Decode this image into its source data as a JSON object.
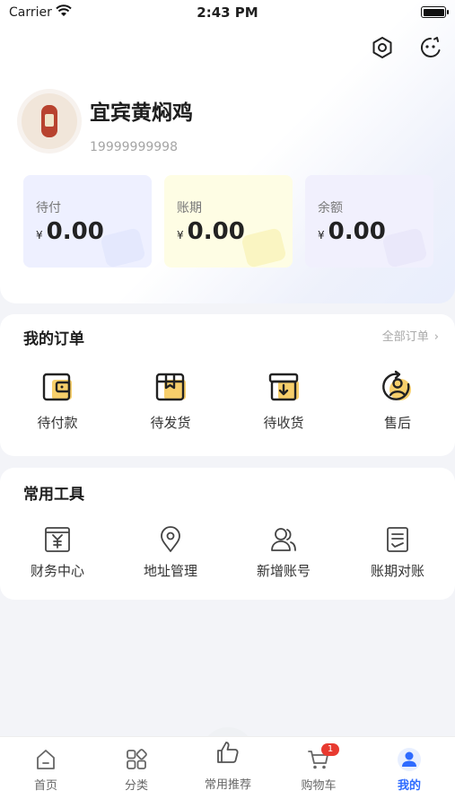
{
  "status_bar": {
    "carrier": "Carrier",
    "time": "2:43 PM"
  },
  "header_icons": {
    "settings": "settings-icon",
    "service": "customer-service-icon"
  },
  "profile": {
    "name": "宜宾黄焖鸡",
    "phone": "19999999998"
  },
  "balances": [
    {
      "label": "待付",
      "currency": "¥",
      "amount": "0.00"
    },
    {
      "label": "账期",
      "currency": "¥",
      "amount": "0.00"
    },
    {
      "label": "余额",
      "currency": "¥",
      "amount": "0.00"
    }
  ],
  "orders": {
    "title": "我的订单",
    "all_label": "全部订单",
    "items": [
      {
        "label": "待付款",
        "icon": "wallet-icon"
      },
      {
        "label": "待发货",
        "icon": "package-icon"
      },
      {
        "label": "待收货",
        "icon": "inbox-icon"
      },
      {
        "label": "售后",
        "icon": "after-sales-icon"
      }
    ]
  },
  "tools": {
    "title": "常用工具",
    "items": [
      {
        "label": "财务中心",
        "icon": "finance-icon"
      },
      {
        "label": "地址管理",
        "icon": "location-icon"
      },
      {
        "label": "新增账号",
        "icon": "users-icon"
      },
      {
        "label": "账期对账",
        "icon": "document-icon"
      }
    ]
  },
  "tabbar": {
    "items": [
      {
        "label": "首页",
        "icon": "home-icon"
      },
      {
        "label": "分类",
        "icon": "category-icon"
      },
      {
        "label": "常用推荐",
        "icon": "thumbs-up-icon"
      },
      {
        "label": "购物车",
        "icon": "cart-icon"
      },
      {
        "label": "我的",
        "icon": "user-icon"
      }
    ],
    "active": "我的",
    "cart_badge": "1"
  },
  "colors": {
    "accent": "#2e6bff",
    "badge": "#e83a30",
    "icon_yellow": "#f7cf6b"
  }
}
